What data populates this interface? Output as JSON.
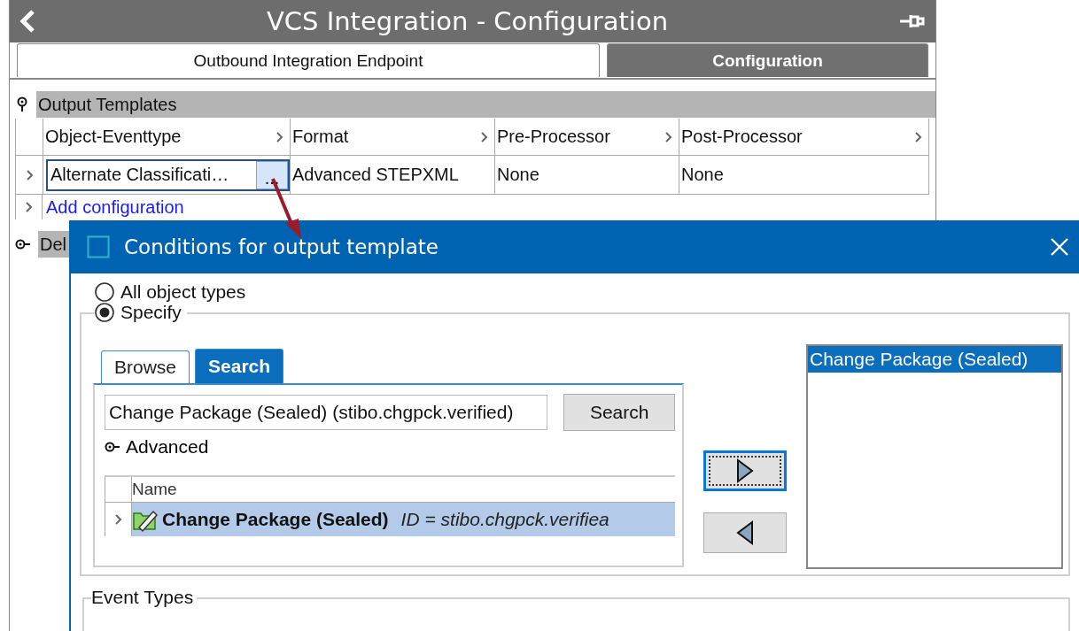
{
  "window": {
    "title": "VCS Integration - Configuration"
  },
  "tabs": [
    {
      "label": "Outbound Integration Endpoint",
      "selected": false
    },
    {
      "label": "Configuration",
      "selected": true
    }
  ],
  "sections": [
    {
      "title": "Output Templates",
      "expanded": true,
      "table": {
        "columns": [
          "Object-Eventtype",
          "Format",
          "Pre-Processor",
          "Post-Processor"
        ],
        "rows": [
          {
            "cells": [
              "Alternate Classificati…",
              "Advanced STEPXML",
              "None",
              "None"
            ],
            "picker": "..."
          }
        ]
      },
      "add_link": "Add configuration"
    },
    {
      "title": "Del",
      "expanded": false
    }
  ],
  "dialog": {
    "title": "Conditions for output template",
    "options": [
      {
        "label": "All object types",
        "selected": false
      },
      {
        "label": "Specify",
        "selected": true
      }
    ],
    "tabs": [
      {
        "label": "Browse",
        "selected": false
      },
      {
        "label": "Search",
        "selected": true
      }
    ],
    "search": {
      "value": "Change Package (Sealed) (stibo.chgpck.verified)",
      "button": "Search"
    },
    "advanced": {
      "label": "Advanced",
      "expanded": false
    },
    "results": {
      "columns": [
        "Name"
      ],
      "rows": [
        {
          "name": "Change Package (Sealed)",
          "id": "ID = stibo.chgpck.verifiea",
          "selected": true
        }
      ]
    },
    "chosen": [
      {
        "label": "Change Package (Sealed)",
        "selected": true
      }
    ],
    "event_types": {
      "legend": "Event Types"
    }
  }
}
